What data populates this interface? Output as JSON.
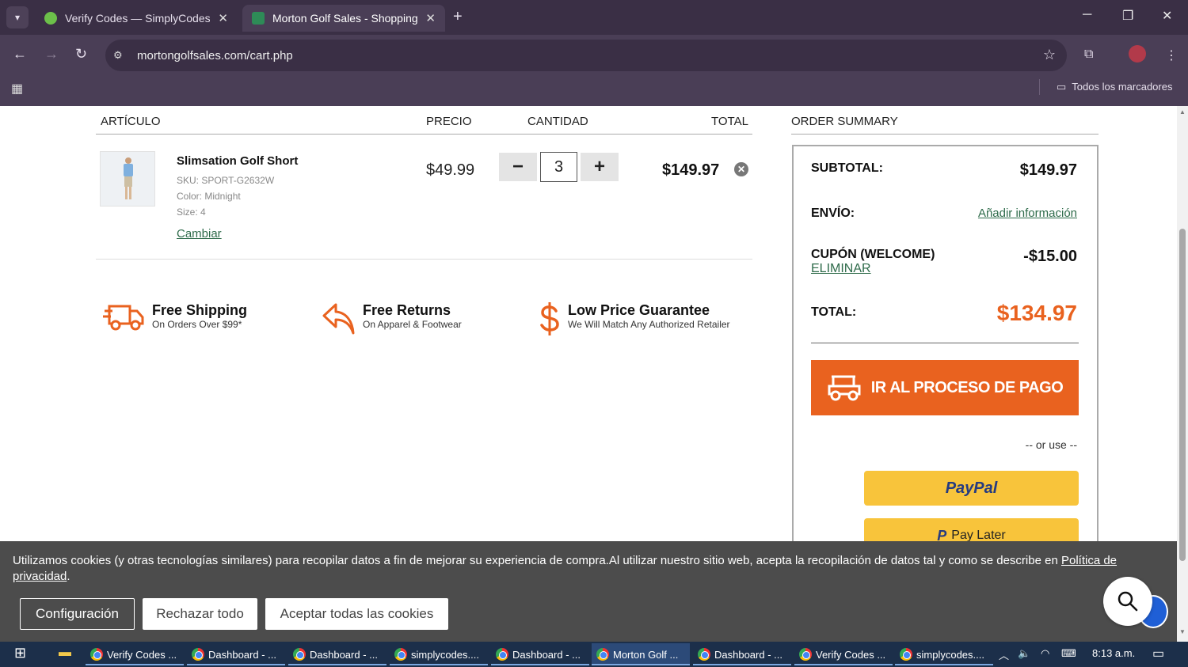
{
  "browser": {
    "tabs": [
      {
        "title": "Verify Codes — SimplyCodes",
        "active": false,
        "favicon_color": "#6cc04a"
      },
      {
        "title": "Morton Golf Sales - Shopping C",
        "active": true,
        "favicon_color": "#2e8b57"
      }
    ],
    "url": "mortongolfsales.com/cart.php",
    "bookmarks_label": "Todos los marcadores"
  },
  "cart": {
    "headers": {
      "item": "ARTÍCULO",
      "price": "PRECIO",
      "qty": "CANTIDAD",
      "total": "TOTAL"
    },
    "item": {
      "name": "Slimsation Golf Short",
      "sku": "SKU: SPORT-G2632W",
      "color": "Color: Midnight",
      "size": "Size: 4",
      "change_link": "Cambiar",
      "price": "$49.99",
      "quantity": "3",
      "line_total": "$149.97",
      "minus": "−",
      "plus": "+",
      "remove": "✕"
    }
  },
  "features": [
    {
      "title": "Free Shipping",
      "subtitle": "On Orders Over $99*",
      "icon": "truck-icon"
    },
    {
      "title": "Free Returns",
      "subtitle": "On Apparel & Footwear",
      "icon": "return-arrow-icon"
    },
    {
      "title": "Low Price Guarantee",
      "subtitle": "We Will Match Any Authorized Retailer",
      "icon": "dollar-icon"
    }
  ],
  "summary": {
    "title": "ORDER SUMMARY",
    "subtotal_label": "SUBTOTAL:",
    "subtotal_value": "$149.97",
    "shipping_label": "ENVÍO:",
    "shipping_link": "Añadir información",
    "coupon_label": "CUPÓN (WELCOME)",
    "coupon_remove": "ELIMINAR",
    "coupon_value": "-$15.00",
    "total_label": "TOTAL:",
    "total_value": "$134.97",
    "checkout_label": "IR AL PROCESO DE PAGO",
    "or_use": "-- or use --",
    "paypal_label": "PayPal",
    "paylater_label": "Pay Later"
  },
  "cookie": {
    "message": "Utilizamos cookies (y otras tecnologías similares) para recopilar datos a fin de mejorar su experiencia de compra.Al utilizar nuestro sitio web, acepta la recopilación de datos tal y como se describe en ",
    "policy_link": "Política de privacidad",
    "message_end": ".",
    "settings_button": "Configuración",
    "reject_button": "Rechazar todo",
    "accept_button": "Aceptar todas las cookies"
  },
  "taskbar": {
    "items": [
      {
        "label": "Verify Codes ...",
        "active": false
      },
      {
        "label": "Dashboard - ...",
        "active": false
      },
      {
        "label": "Dashboard - ...",
        "active": false
      },
      {
        "label": "simplycodes....",
        "active": false
      },
      {
        "label": "Dashboard - ...",
        "active": false
      },
      {
        "label": "Morton Golf ...",
        "active": true
      },
      {
        "label": "Dashboard - ...",
        "active": false
      },
      {
        "label": "Verify Codes ...",
        "active": false
      },
      {
        "label": "simplycodes....",
        "active": false
      }
    ],
    "clock": "8:13 a.m."
  },
  "colors": {
    "accent_orange": "#e9621f",
    "link_green": "#2e6b4a",
    "paypal_yellow": "#f8c43b",
    "browser_frame": "#3a2f45"
  }
}
